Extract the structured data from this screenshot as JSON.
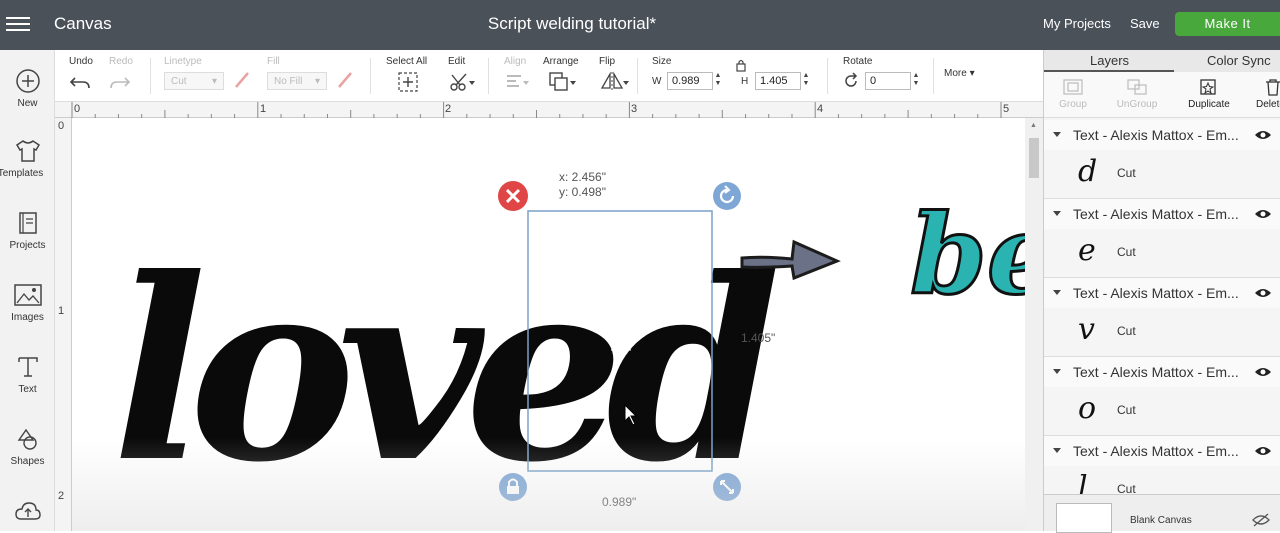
{
  "header": {
    "app_title": "Canvas",
    "doc_title": "Script welding tutorial*",
    "my_projects": "My Projects",
    "save": "Save",
    "make_it": "Make It"
  },
  "sidebar": {
    "items": [
      {
        "label": "New",
        "icon": "plus-circle-icon"
      },
      {
        "label": "Templates",
        "icon": "shirt-icon"
      },
      {
        "label": "Projects",
        "icon": "projects-icon"
      },
      {
        "label": "Images",
        "icon": "image-icon"
      },
      {
        "label": "Text",
        "icon": "text-icon"
      },
      {
        "label": "Shapes",
        "icon": "shapes-icon"
      },
      {
        "label": "",
        "icon": "upload-icon"
      }
    ]
  },
  "toolbar": {
    "undo": "Undo",
    "redo": "Redo",
    "linetype": "Linetype",
    "linetype_value": "Cut",
    "fill": "Fill",
    "fill_value": "No Fill",
    "select_all": "Select All",
    "edit": "Edit",
    "align": "Align",
    "arrange": "Arrange",
    "flip": "Flip",
    "size": "Size",
    "w_label": "W",
    "w_value": "0.989",
    "h_label": "H",
    "h_value": "1.405",
    "rotate": "Rotate",
    "rotate_value": "0",
    "more": "More"
  },
  "rulers": {
    "top": [
      "0",
      "1",
      "2",
      "3",
      "4",
      "5"
    ],
    "left": [
      "0",
      "1",
      "2"
    ]
  },
  "canvas": {
    "coord_x": "x: 2.456\"",
    "coord_y": "y: 0.498\"",
    "height_readout": "1.405\"",
    "width_readout": "0.989\"",
    "word": "loved",
    "partial_word": "be",
    "accent_color": "#2bb3b1"
  },
  "panel": {
    "tab_layers": "Layers",
    "tab_color_sync": "Color Sync",
    "tools": [
      "Group",
      "UnGroup",
      "Duplicate",
      "Delete"
    ],
    "layers": [
      {
        "title": "Text - Alexis Mattox - Em...",
        "glyph": "d",
        "op": "Cut"
      },
      {
        "title": "Text - Alexis Mattox - Em...",
        "glyph": "e",
        "op": "Cut"
      },
      {
        "title": "Text - Alexis Mattox - Em...",
        "glyph": "v",
        "op": "Cut"
      },
      {
        "title": "Text - Alexis Mattox - Em...",
        "glyph": "o",
        "op": "Cut"
      },
      {
        "title": "Text - Alexis Mattox - Em...",
        "glyph": "l",
        "op": "Cut"
      }
    ],
    "blank_canvas": "Blank Canvas"
  }
}
